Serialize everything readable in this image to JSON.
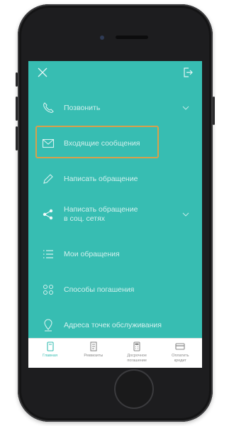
{
  "menu": {
    "items": [
      {
        "label": "Позвонить",
        "icon": "phone-icon",
        "has_chevron": true
      },
      {
        "label": "Входящие сообщения",
        "icon": "envelope-icon",
        "has_chevron": false
      },
      {
        "label": "Написать обращение",
        "icon": "pencil-icon",
        "has_chevron": false
      },
      {
        "label": "Написать обращение\nв соц. сетях",
        "icon": "share-icon",
        "has_chevron": true
      },
      {
        "label": "Мои обращения",
        "icon": "list-icon",
        "has_chevron": false
      },
      {
        "label": "Способы погашения",
        "icon": "grid-icon",
        "has_chevron": false
      },
      {
        "label": "Адреса точек обслуживания",
        "icon": "location-icon",
        "has_chevron": false
      }
    ]
  },
  "tabbar": {
    "tabs": [
      {
        "label": "Главная",
        "icon": "home-card-icon",
        "active": true
      },
      {
        "label": "Реквизиты",
        "icon": "document-icon",
        "active": false
      },
      {
        "label": "Досрочное\nпогашение",
        "icon": "calculator-icon",
        "active": false
      },
      {
        "label": "Оплатить\nкредит",
        "icon": "credit-card-icon",
        "active": false
      }
    ]
  },
  "colors": {
    "screen_bg": "#37bdb2",
    "highlight": "#d9a04b",
    "tab_active": "#37bdb2"
  }
}
